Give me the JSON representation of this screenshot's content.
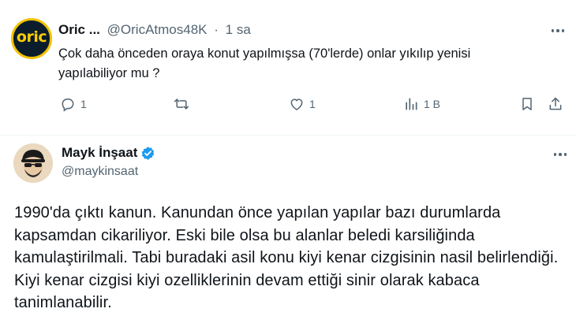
{
  "reply": {
    "author_name": "Oric ...",
    "author_handle": "@OricAtmos48K",
    "separator": "·",
    "time": "1 sa",
    "avatar_text": "oric",
    "text": "Çok daha önceden oraya konut yapılmışsa (70'lerde) onlar yıkılıp yenisi yapılabiliyor mu ?",
    "stats": {
      "replies": "1",
      "retweets": "",
      "likes": "1",
      "views": "1 B"
    },
    "icons": [
      "reply-icon",
      "retweet-icon",
      "like-icon",
      "views-icon",
      "bookmark-icon",
      "share-icon",
      "more-icon"
    ]
  },
  "main_tweet": {
    "author_name": "Mayk İnşaat",
    "author_handle": "@maykinsaat",
    "verified": true,
    "text": "1990'da çıktı kanun. Kanundan önce yapılan yapılar bazı durumlarda kapsamdan cikariliyor. Eski bile olsa bu alanlar beledi karsiliğinda kamulaştirilmali. Tabi buradaki asil konu kiyi kenar cizgisinin nasil belirlendiği. Kiyi kenar cizgisi kiyi ozelliklerinin devam ettiği sinir olarak kabaca tanimlanabilir."
  },
  "colors": {
    "text": "#0f1419",
    "secondary": "#536471",
    "verified": "#1d9bf0",
    "oric_bg": "#0b1c2d",
    "oric_yellow": "#ffcc00"
  }
}
